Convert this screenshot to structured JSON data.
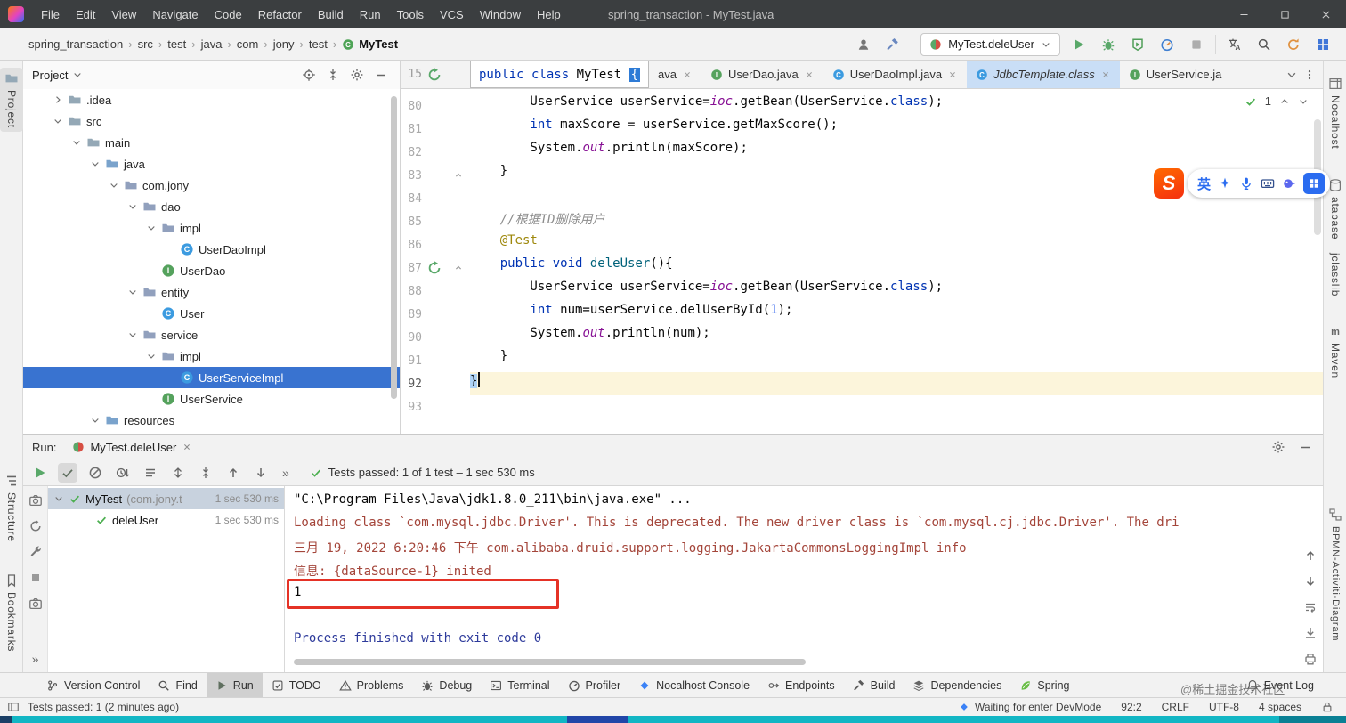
{
  "titlebar": {
    "title": "spring_transaction - MyTest.java",
    "menus": [
      "File",
      "Edit",
      "View",
      "Navigate",
      "Code",
      "Refactor",
      "Build",
      "Run",
      "Tools",
      "VCS",
      "Window",
      "Help"
    ]
  },
  "toolbar": {
    "breadcrumbs": [
      "spring_transaction",
      "src",
      "test",
      "java",
      "com",
      "jony",
      "test",
      "MyTest"
    ],
    "run_config": "MyTest.deleUser"
  },
  "left_strip": {
    "labels": [
      "Project",
      "Structure",
      "Bookmarks"
    ]
  },
  "right_strip": {
    "labels": [
      "Nocalhost",
      "atabase",
      "jclasslib",
      "Maven",
      "BPMN-Activiti-Diagram"
    ]
  },
  "project_panel": {
    "title": "Project",
    "tree": [
      {
        "depth": 1,
        "chevron": "r",
        "icon": "folder",
        "label": ".idea"
      },
      {
        "depth": 1,
        "chevron": "d",
        "icon": "folder",
        "label": "src"
      },
      {
        "depth": 2,
        "chevron": "d",
        "icon": "folder",
        "label": "main"
      },
      {
        "depth": 3,
        "chevron": "d",
        "icon": "folderB",
        "label": "java"
      },
      {
        "depth": 4,
        "chevron": "d",
        "icon": "pkg",
        "label": "com.jony"
      },
      {
        "depth": 5,
        "chevron": "d",
        "icon": "pkg",
        "label": "dao"
      },
      {
        "depth": 6,
        "chevron": "d",
        "icon": "pkg",
        "label": "impl"
      },
      {
        "depth": 7,
        "chevron": "",
        "icon": "cls",
        "label": "UserDaoImpl"
      },
      {
        "depth": 6,
        "chevron": "",
        "icon": "itf",
        "label": "UserDao"
      },
      {
        "depth": 5,
        "chevron": "d",
        "icon": "pkg",
        "label": "entity"
      },
      {
        "depth": 6,
        "chevron": "",
        "icon": "cls",
        "label": "User"
      },
      {
        "depth": 5,
        "chevron": "d",
        "icon": "pkg",
        "label": "service"
      },
      {
        "depth": 6,
        "chevron": "d",
        "icon": "pkg",
        "label": "impl"
      },
      {
        "depth": 7,
        "chevron": "",
        "icon": "cls",
        "label": "UserServiceImpl",
        "selected": true
      },
      {
        "depth": 6,
        "chevron": "",
        "icon": "itf",
        "label": "UserService"
      },
      {
        "depth": 3,
        "chevron": "d",
        "icon": "folderB",
        "label": "resources"
      }
    ]
  },
  "editor": {
    "sticky_line": {
      "number": "15",
      "segments": [
        [
          "kw",
          "public class "
        ],
        [
          "plain",
          "MyTest "
        ],
        [
          "brace",
          "{"
        ]
      ]
    },
    "inspection": {
      "count": "1"
    },
    "tabs": [
      {
        "label": "ava",
        "icon": "",
        "close": true
      },
      {
        "label": "UserDao.java",
        "icon": "itf",
        "close": true
      },
      {
        "label": "UserDaoImpl.java",
        "icon": "cls",
        "close": true
      },
      {
        "label": "JdbcTemplate.class",
        "icon": "cls",
        "close": true,
        "active": true
      },
      {
        "label": "UserService.ja",
        "icon": "itf",
        "close": false
      }
    ],
    "lines": [
      {
        "n": "80",
        "segments": [
          [
            "plain",
            "        UserService userService="
          ],
          [
            "fld",
            "ioc"
          ],
          [
            "plain",
            ".getBean(UserService."
          ],
          [
            "kw",
            "class"
          ],
          [
            "plain",
            ");"
          ]
        ]
      },
      {
        "n": "81",
        "segments": [
          [
            "kw",
            "        int"
          ],
          [
            "plain",
            " maxScore = userService.getMaxScore();"
          ]
        ]
      },
      {
        "n": "82",
        "segments": [
          [
            "plain",
            "        System."
          ],
          [
            "fld",
            "out"
          ],
          [
            "plain",
            ".println(maxScore);"
          ]
        ]
      },
      {
        "n": "83",
        "fold": true,
        "segments": [
          [
            "plain",
            "    }"
          ]
        ]
      },
      {
        "n": "84",
        "segments": []
      },
      {
        "n": "85",
        "segments": [
          [
            "cmt",
            "    //根据ID删除用户"
          ]
        ]
      },
      {
        "n": "86",
        "segments": [
          [
            "ann",
            "    @Test"
          ]
        ]
      },
      {
        "n": "87",
        "run": true,
        "fold": true,
        "segments": [
          [
            "kw",
            "    public void "
          ],
          [
            "mth",
            "deleUser"
          ],
          [
            "plain",
            "(){"
          ]
        ]
      },
      {
        "n": "88",
        "segments": [
          [
            "plain",
            "        UserService userService="
          ],
          [
            "fld",
            "ioc"
          ],
          [
            "plain",
            ".getBean(UserService."
          ],
          [
            "kw",
            "class"
          ],
          [
            "plain",
            ");"
          ]
        ]
      },
      {
        "n": "89",
        "segments": [
          [
            "kw",
            "        int"
          ],
          [
            "plain",
            " num=userService.delUserById("
          ],
          [
            "num",
            "1"
          ],
          [
            "plain",
            ");"
          ]
        ]
      },
      {
        "n": "90",
        "segments": [
          [
            "plain",
            "        System."
          ],
          [
            "fld",
            "out"
          ],
          [
            "plain",
            ".println(num);"
          ]
        ]
      },
      {
        "n": "91",
        "segments": [
          [
            "plain",
            "    }"
          ]
        ]
      },
      {
        "n": "92",
        "current": true,
        "caret": true,
        "segments": [
          [
            "brace2",
            "}"
          ]
        ]
      },
      {
        "n": "93",
        "segments": []
      }
    ]
  },
  "run_panel": {
    "label": "Run:",
    "tab": "MyTest.deleUser",
    "status": "Tests passed: 1 of 1 test – 1 sec 530 ms",
    "tests": [
      {
        "name": "MyTest",
        "suffix": "(com.jony.t",
        "time": "1 sec 530 ms",
        "selected": true,
        "chevron": true,
        "indent": 0
      },
      {
        "name": "deleUser",
        "suffix": "",
        "time": "1 sec 530 ms",
        "indent": 1
      }
    ],
    "console": [
      {
        "style": "plain",
        "text": "\"C:\\Program Files\\Java\\jdk1.8.0_211\\bin\\java.exe\" ..."
      },
      {
        "style": "error",
        "text": "Loading class `com.mysql.jdbc.Driver'. This is deprecated. The new driver class is `com.mysql.cj.jdbc.Driver'. The dri"
      },
      {
        "style": "error",
        "text": "三月 19, 2022 6:20:46 下午 com.alibaba.druid.support.logging.JakartaCommonsLoggingImpl info"
      },
      {
        "style": "error",
        "text": "信息: {dataSource-1} inited"
      },
      {
        "style": "plain",
        "text": "1"
      },
      {
        "style": "plain",
        "text": ""
      },
      {
        "style": "system",
        "text": "Process finished with exit code 0"
      }
    ]
  },
  "bottom_bar": {
    "items": [
      {
        "label": "Version Control",
        "icon": "branch"
      },
      {
        "label": "Find",
        "icon": "search2"
      },
      {
        "label": "Run",
        "icon": "playSmall",
        "active": true
      },
      {
        "label": "TODO",
        "icon": "todo"
      },
      {
        "label": "Problems",
        "icon": "problems"
      },
      {
        "label": "Debug",
        "icon": "bugGray"
      },
      {
        "label": "Terminal",
        "icon": "terminal"
      },
      {
        "label": "Profiler",
        "icon": "profiler2"
      },
      {
        "label": "Nocalhost Console",
        "icon": "nocal"
      },
      {
        "label": "Endpoints",
        "icon": "endpoints"
      },
      {
        "label": "Build",
        "icon": "hammerGray"
      },
      {
        "label": "Dependencies",
        "icon": "deps"
      },
      {
        "label": "Spring",
        "icon": "spring"
      }
    ],
    "right_item": {
      "label": "Event Log",
      "icon": "bell"
    }
  },
  "statusbar": {
    "message": "Tests passed: 1 (2 minutes ago)",
    "devmode": "Waiting for enter DevMode",
    "caret_position": "92:2",
    "line_separator": "CRLF",
    "encoding": "UTF-8",
    "indent": "4 spaces"
  },
  "ime": {
    "logo": "S",
    "lang": "英"
  },
  "watermark": "@稀土掘金技术社区"
}
